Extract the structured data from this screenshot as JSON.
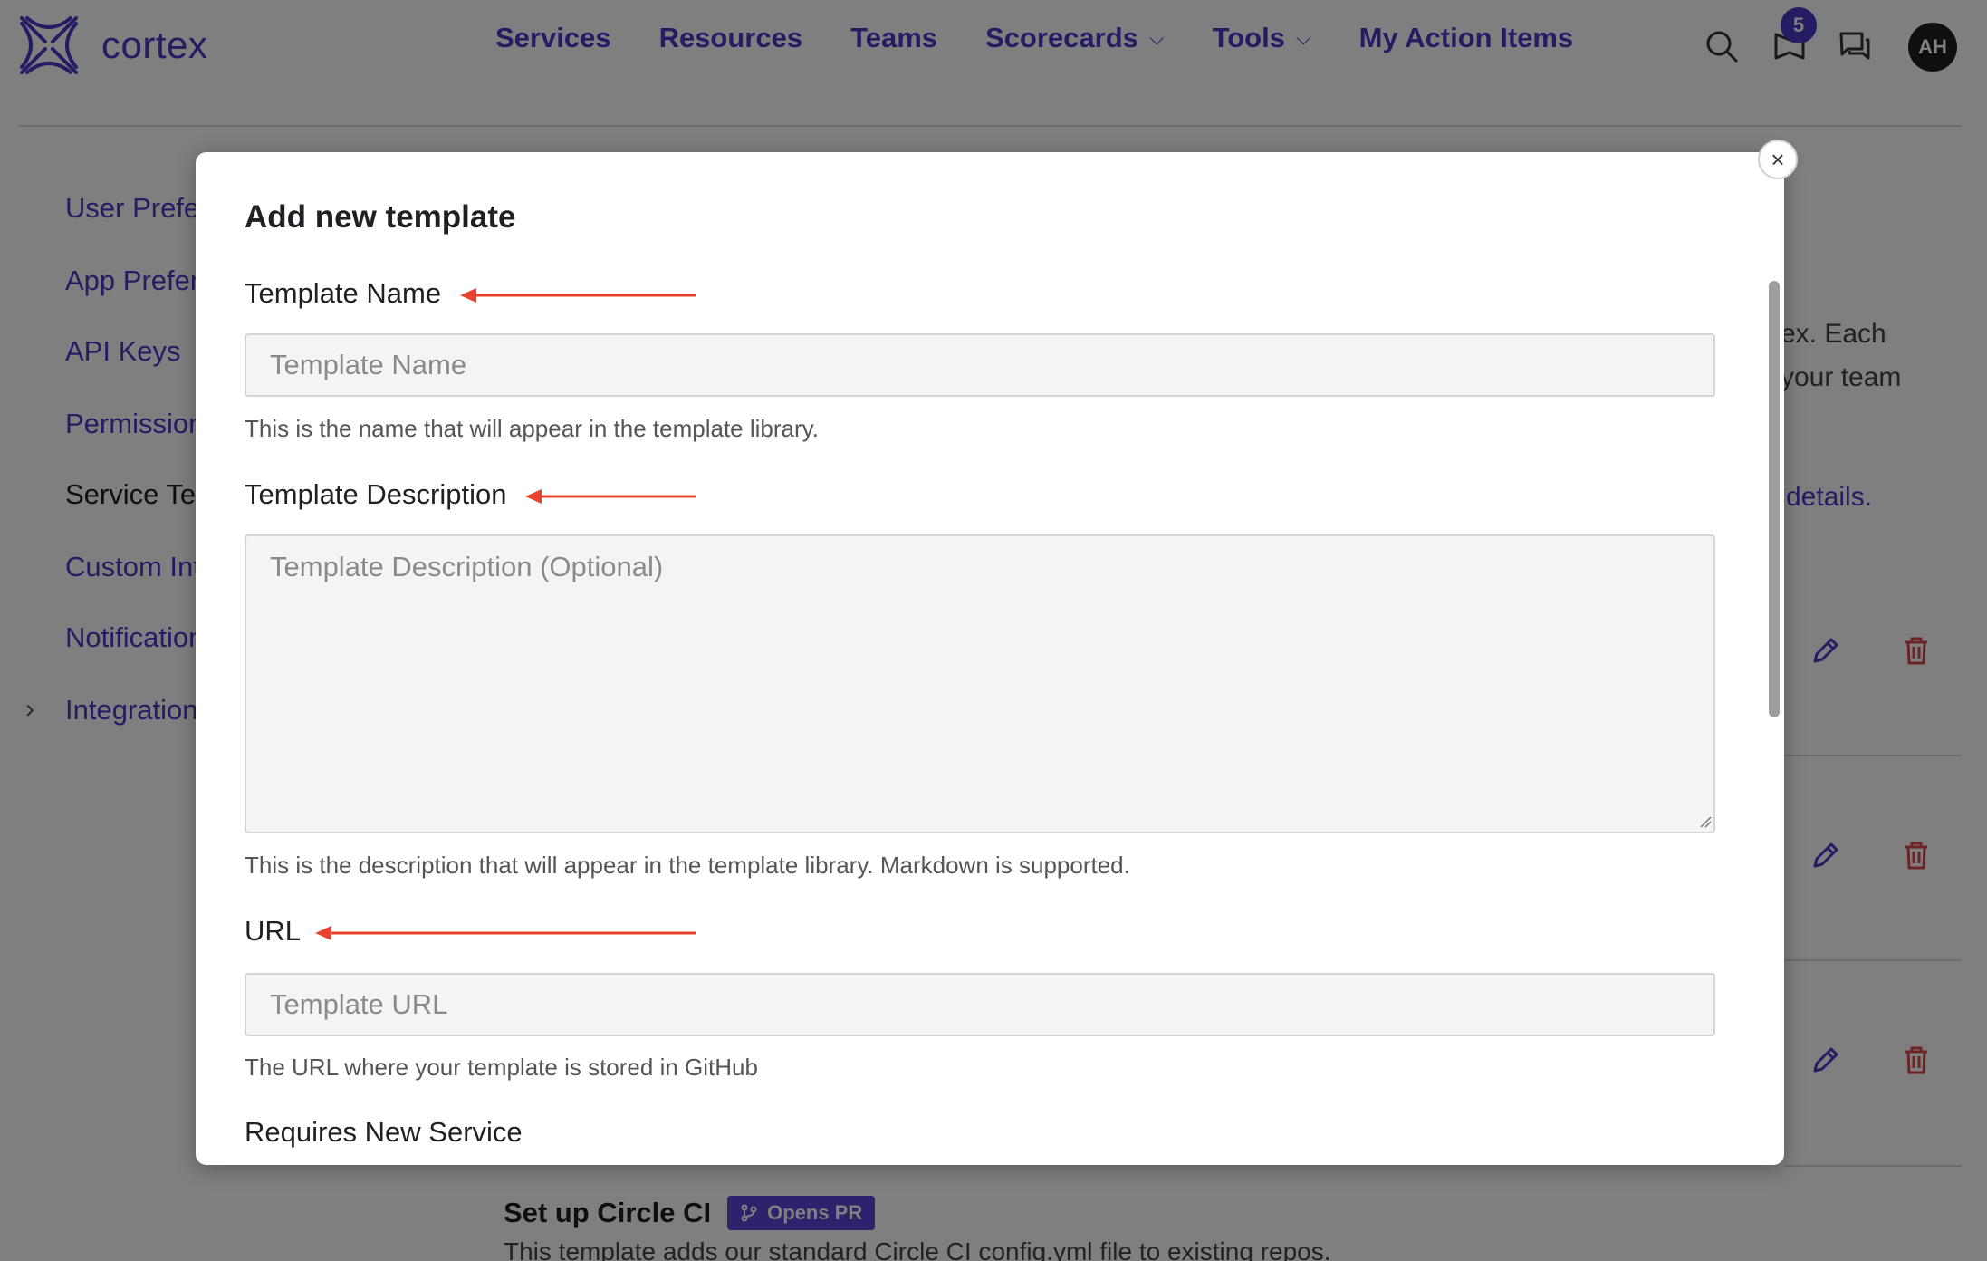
{
  "brand": {
    "name": "cortex",
    "color": "#4b3bc9"
  },
  "nav": {
    "items": [
      {
        "label": "Services",
        "dropdown": false
      },
      {
        "label": "Resources",
        "dropdown": false
      },
      {
        "label": "Teams",
        "dropdown": false
      },
      {
        "label": "Scorecards",
        "dropdown": true
      },
      {
        "label": "Tools",
        "dropdown": true
      },
      {
        "label": "My Action Items",
        "dropdown": false
      }
    ],
    "notification_count": "5",
    "avatar_initials": "AH"
  },
  "sidebar": {
    "items": [
      {
        "label": "User Preferences"
      },
      {
        "label": "App Preferences"
      },
      {
        "label": "API Keys"
      },
      {
        "label": "Permissions"
      },
      {
        "label": "Service Templates"
      },
      {
        "label": "Custom Integrations"
      },
      {
        "label": "Notifications"
      },
      {
        "label": "Integrations"
      }
    ]
  },
  "background": {
    "desc_line1": "ex. Each",
    "desc_line2": "your team",
    "details_link": "details.",
    "bottom_row_title": "Set up Circle CI",
    "bottom_row_badge": "Opens PR",
    "bottom_row_desc": "This template adds our standard Circle CI config.yml file to existing repos."
  },
  "modal": {
    "title": "Add new template",
    "name_label": "Template Name",
    "name_placeholder": "Template Name",
    "name_help": "This is the name that will appear in the template library.",
    "desc_label": "Template Description",
    "desc_placeholder": "Template Description (Optional)",
    "desc_help": "This is the description that will appear in the template library. Markdown is supported.",
    "url_label": "URL",
    "url_placeholder": "Template URL",
    "url_help": "The URL where your template is stored in GitHub",
    "requires_label": "Requires New Service",
    "close_symbol": "×"
  },
  "colors": {
    "accent": "#4b3bc9",
    "annotation_arrow": "#e8432e",
    "danger": "#d94a4a"
  }
}
